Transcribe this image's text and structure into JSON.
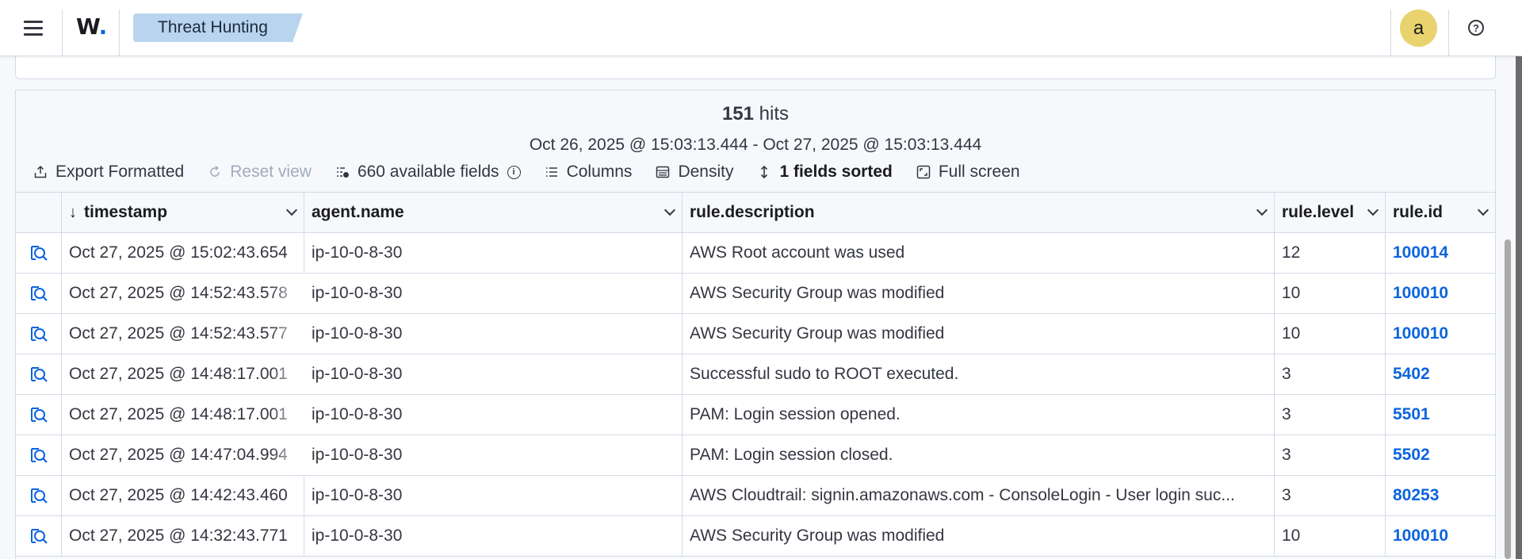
{
  "header": {
    "logo_text": "W",
    "logo_dot": ".",
    "breadcrumb": "Threat Hunting",
    "avatar_letter": "a",
    "help_glyph": "?"
  },
  "summary": {
    "hits_count": "151",
    "hits_label": "hits",
    "time_range": "Oct 26, 2025 @ 15:03:13.444 - Oct 27, 2025 @ 15:03:13.444"
  },
  "toolbar": {
    "export": "Export Formatted",
    "reset": "Reset view",
    "fields": "660 available fields",
    "columns": "Columns",
    "density": "Density",
    "sorted": "1 fields sorted",
    "fullscreen": "Full screen"
  },
  "table": {
    "columns": [
      "timestamp",
      "agent.name",
      "rule.description",
      "rule.level",
      "rule.id"
    ],
    "rows": [
      {
        "timestamp": "Oct 27, 2025 @ 15:02:43.654",
        "agent": "ip-10-0-8-30",
        "description": "AWS Root account was used",
        "level": "12",
        "rule_id": "100014"
      },
      {
        "timestamp": "Oct 27, 2025 @ 14:52:43.578",
        "agent": "ip-10-0-8-30",
        "description": "AWS Security Group was modified",
        "level": "10",
        "rule_id": "100010"
      },
      {
        "timestamp": "Oct 27, 2025 @ 14:52:43.577",
        "agent": "ip-10-0-8-30",
        "description": "AWS Security Group was modified",
        "level": "10",
        "rule_id": "100010"
      },
      {
        "timestamp": "Oct 27, 2025 @ 14:48:17.001",
        "agent": "ip-10-0-8-30",
        "description": "Successful sudo to ROOT executed.",
        "level": "3",
        "rule_id": "5402"
      },
      {
        "timestamp": "Oct 27, 2025 @ 14:48:17.001",
        "agent": "ip-10-0-8-30",
        "description": "PAM: Login session opened.",
        "level": "3",
        "rule_id": "5501"
      },
      {
        "timestamp": "Oct 27, 2025 @ 14:47:04.994",
        "agent": "ip-10-0-8-30",
        "description": "PAM: Login session closed.",
        "level": "3",
        "rule_id": "5502"
      },
      {
        "timestamp": "Oct 27, 2025 @ 14:42:43.460",
        "agent": "ip-10-0-8-30",
        "description": "AWS Cloudtrail: signin.amazonaws.com - ConsoleLogin - User login suc...",
        "level": "3",
        "rule_id": "80253"
      },
      {
        "timestamp": "Oct 27, 2025 @ 14:32:43.771",
        "agent": "ip-10-0-8-30",
        "description": "AWS Security Group was modified",
        "level": "10",
        "rule_id": "100010"
      }
    ]
  },
  "colors": {
    "accent": "#0b64dd",
    "breadcrumb_bg": "#b9d4ee",
    "avatar_bg": "#e8d36e"
  },
  "icons": [
    "menu-icon",
    "help-icon",
    "export-icon",
    "reset-icon",
    "fields-icon",
    "info-icon",
    "columns-icon",
    "density-icon",
    "sort-icon",
    "fullscreen-icon",
    "inspect-document-icon",
    "chevron-down-icon",
    "sort-descending-icon"
  ]
}
